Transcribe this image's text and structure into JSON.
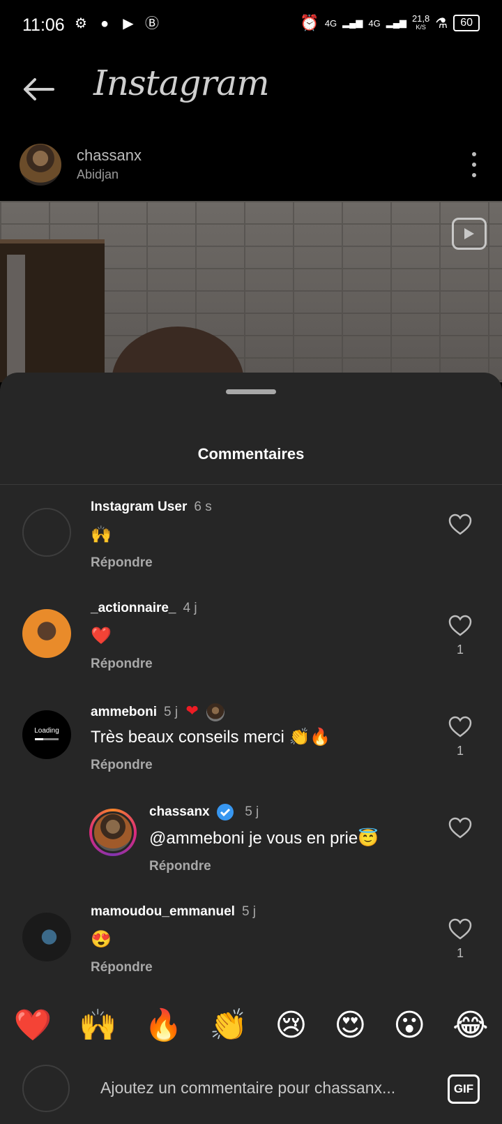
{
  "status_bar": {
    "time": "11:06",
    "left_icons": [
      "gear-icon",
      "chat-icon",
      "youtube-icon",
      "b-icon"
    ],
    "network_1": "4G",
    "network_2": "4G",
    "speed": "21,8",
    "speed_unit": "K/S",
    "battery": "60"
  },
  "app_bar": {
    "title": "Instagram"
  },
  "post": {
    "username": "chassanx",
    "location": "Abidjan"
  },
  "sheet": {
    "title": "Commentaires",
    "comments": [
      {
        "user": "Instagram User",
        "time": "6 s",
        "text": "🙌",
        "reply": "Répondre",
        "likes": ""
      },
      {
        "user": "_actionnaire_",
        "time": "4 j",
        "text": "❤️",
        "reply": "Répondre",
        "likes": "1"
      },
      {
        "user": "ammeboni",
        "time": "5 j",
        "text": "Très beaux conseils merci 👏🔥",
        "reply": "Répondre",
        "likes": "1",
        "avatar_text": "Loading"
      },
      {
        "user": "chassanx",
        "time": "5 j",
        "text": "@ammeboni je vous en prie😇",
        "reply": "Répondre",
        "likes": ""
      },
      {
        "user": "mamoudou_emmanuel",
        "time": "5 j",
        "text": "😍",
        "reply": "Répondre",
        "likes": "1"
      }
    ]
  },
  "emoji_bar": [
    "❤️",
    "🙌",
    "🔥",
    "👏",
    "😢",
    "😍",
    "😮",
    "😂"
  ],
  "composer": {
    "placeholder": "Ajoutez un commentaire pour chassanx...",
    "gif_label": "GIF"
  },
  "colors": {
    "background": "#000000",
    "sheet": "#262626",
    "secondary_text": "#a8a8a8",
    "verified": "#3897f0",
    "heart_red": "#ed1c24"
  }
}
